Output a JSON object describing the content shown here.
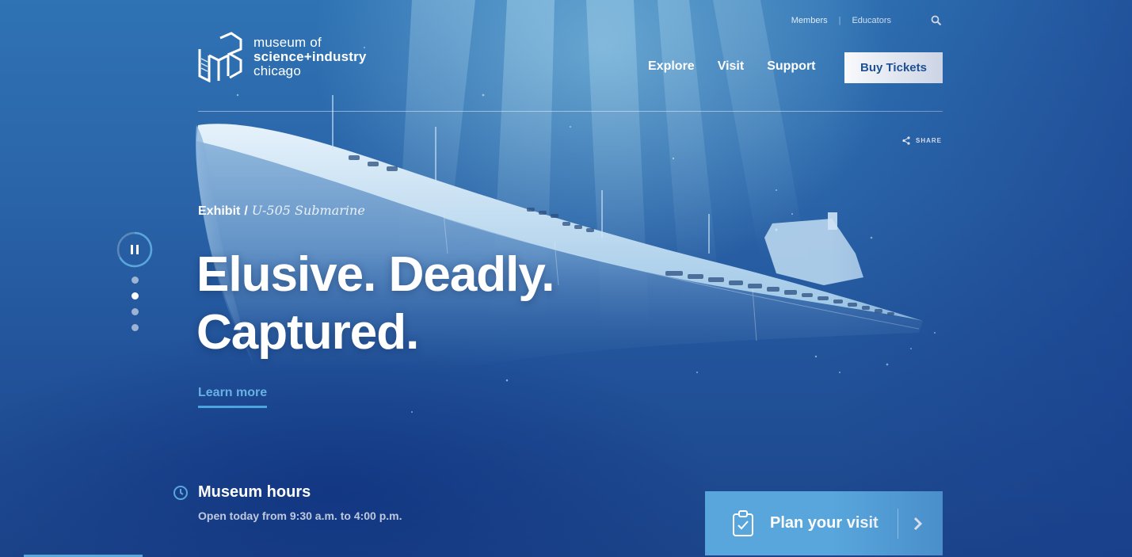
{
  "logo": {
    "line1": "museum of",
    "line2": "science+industry",
    "line3": "chicago"
  },
  "utility_nav": {
    "members": "Members",
    "educators": "Educators",
    "search_icon": "search-icon"
  },
  "main_nav": {
    "items": [
      "Explore",
      "Visit",
      "Support"
    ],
    "cta": "Buy Tickets"
  },
  "share": {
    "label": "SHARE",
    "icon": "share-icon"
  },
  "slider": {
    "control_icon": "pause-icon",
    "slide_count": 4,
    "active_slide": 2
  },
  "hero": {
    "category": "Exhibit",
    "separator": "/",
    "exhibit_title": "U-505 Submarine",
    "headline_line1": "Elusive. Deadly.",
    "headline_line2": "Captured.",
    "link": "Learn more"
  },
  "hours": {
    "title": "Museum hours",
    "detail": "Open today from 9:30 a.m. to 4:00 p.m.",
    "icon": "clock-icon"
  },
  "plan_visit": {
    "label": "Plan your visit",
    "icon": "clipboard-icon",
    "arrow_icon": "chevron-right-icon"
  },
  "colors": {
    "accent": "#58a6dc",
    "link": "#66b1e6",
    "button_text": "#1e5393"
  }
}
